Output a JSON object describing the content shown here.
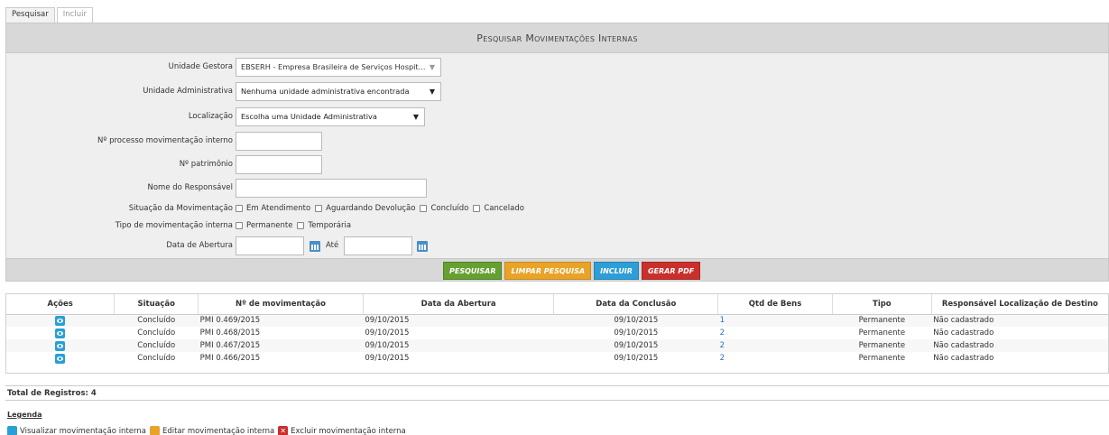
{
  "tabs": [
    {
      "label": "Pesquisar",
      "active": true
    },
    {
      "label": "Incluir",
      "active": false
    }
  ],
  "title": "Pesquisar Movimentações Internas",
  "form": {
    "unidade_gestora": {
      "label": "Unidade Gestora",
      "value": "EBSERH - Empresa Brasileira de Serviços Hospit..."
    },
    "unidade_administrativa": {
      "label": "Unidade Administrativa",
      "value": "Nenhuma unidade administrativa encontrada"
    },
    "localizacao": {
      "label": "Localização",
      "value": "Escolha uma Unidade Administrativa"
    },
    "processo": {
      "label": "Nº processo movimentação interno",
      "value": ""
    },
    "patrimonio": {
      "label": "Nº patrimônio",
      "value": ""
    },
    "responsavel": {
      "label": "Nome do Responsável",
      "value": ""
    },
    "situacao": {
      "label": "Situação da Movimentação",
      "options": [
        "Em Atendimento",
        "Aguardando Devolução",
        "Concluído",
        "Cancelado"
      ]
    },
    "tipo": {
      "label": "Tipo de movimentação interna",
      "options": [
        "Permanente",
        "Temporária"
      ]
    },
    "data_abertura": {
      "label": "Data de Abertura",
      "ate_label": "Até",
      "from": "",
      "to": ""
    }
  },
  "buttons": {
    "pesquisar": "Pesquisar",
    "limpar": "Limpar Pesquisa",
    "incluir": "Incluir",
    "gerar_pdf": "Gerar PDF"
  },
  "table": {
    "headers": [
      "Ações",
      "Situação",
      "Nº de movimentação",
      "Data da Abertura",
      "Data da Conclusão",
      "Qtd de Bens",
      "Tipo",
      "Responsável Localização de Destino"
    ],
    "rows": [
      [
        "Concluído",
        "PMI 0.469/2015",
        "09/10/2015",
        "09/10/2015",
        "1",
        "Permanente",
        "Não cadastrado"
      ],
      [
        "Concluído",
        "PMI 0.468/2015",
        "09/10/2015",
        "09/10/2015",
        "2",
        "Permanente",
        "Não cadastrado"
      ],
      [
        "Concluído",
        "PMI 0.467/2015",
        "09/10/2015",
        "09/10/2015",
        "2",
        "Permanente",
        "Não cadastrado"
      ],
      [
        "Concluído",
        "PMI 0.466/2015",
        "09/10/2015",
        "09/10/2015",
        "2",
        "Permanente",
        "Não cadastrado"
      ]
    ]
  },
  "total": "Total de Registros: 4",
  "legend": {
    "title": "Legenda",
    "view": "Visualizar movimentação interna",
    "edit": "Editar movimentação interna",
    "delete": "Excluir movimentação interna"
  }
}
